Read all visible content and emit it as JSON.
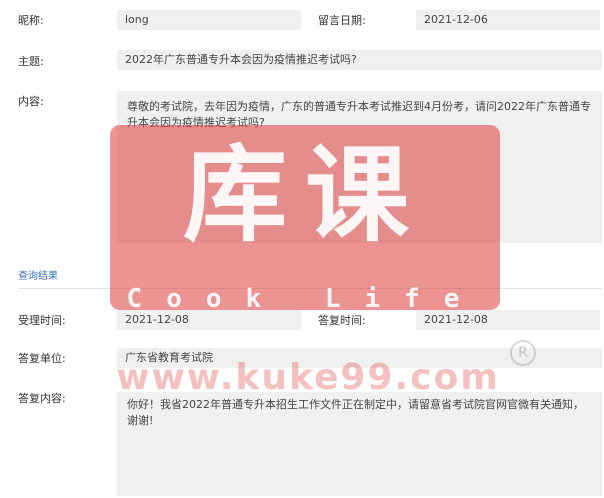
{
  "message": {
    "nickname_label": "昵称:",
    "nickname_value": "long",
    "date_label": "留言日期:",
    "date_value": "2021-12-06",
    "subject_label": "主题:",
    "subject_value": "2022年广东普通专升本会因为疫情推迟考试吗?",
    "content_label": "内容:",
    "content_value": "尊敬的考试院，去年因为疫情，广东的普通专升本考试推迟到4月份考，请问2022年广东普通专升本会因为疫情推迟考试吗?"
  },
  "result": {
    "section_label": "查询结果",
    "accept_time_label": "受理时间:",
    "accept_time_value": "2021-12-08",
    "reply_time_label": "答复时间:",
    "reply_time_value": "2021-12-08",
    "reply_unit_label": "答复单位:",
    "reply_unit_value": "广东省教育考试院",
    "reply_content_label": "答复内容:",
    "reply_content_value": "你好！我省2022年普通专升本招生工作文件正在制定中，请留意省考试院官网官微有关通知，谢谢!"
  },
  "watermark": {
    "title": "库课",
    "subtitle": "Cook Life",
    "url": "www.kuke99.com",
    "registered": "R",
    "color": "#dc3c3c"
  }
}
